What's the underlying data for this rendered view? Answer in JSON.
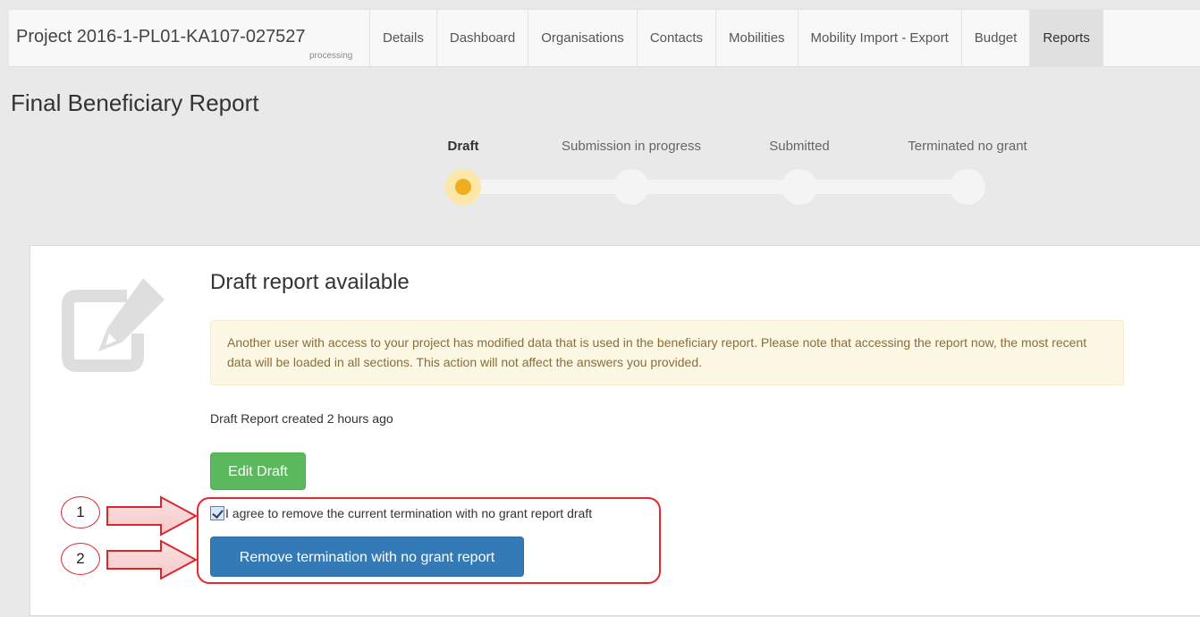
{
  "header": {
    "project_title": "Project 2016-1-PL01-KA107-027527",
    "project_status": "processing",
    "nav": [
      {
        "label": "Details",
        "active": false
      },
      {
        "label": "Dashboard",
        "active": false
      },
      {
        "label": "Organisations",
        "active": false
      },
      {
        "label": "Contacts",
        "active": false
      },
      {
        "label": "Mobilities",
        "active": false
      },
      {
        "label": "Mobility Import - Export",
        "active": false
      },
      {
        "label": "Budget",
        "active": false
      },
      {
        "label": "Reports",
        "active": true
      }
    ]
  },
  "page": {
    "title": "Final Beneficiary Report"
  },
  "steps": [
    {
      "label": "Draft",
      "current": true
    },
    {
      "label": "Submission in progress",
      "current": false
    },
    {
      "label": "Submitted",
      "current": false
    },
    {
      "label": "Terminated no grant",
      "current": false
    }
  ],
  "card": {
    "icon": "edit-document-icon",
    "title": "Draft report available",
    "alert_text": "Another user with access to your project has modified data that is used in the beneficiary report. Please note that accessing the report now, the most recent data will be loaded in all sections. This action will not affect the answers you provided.",
    "created_text": "Draft Report created 2 hours ago",
    "edit_button": "Edit Draft",
    "agree_label": "I agree to remove the current termination with no grant report draft",
    "agree_checked": true,
    "remove_button": "Remove termination with no grant report"
  },
  "annotations": {
    "marker_1": "1",
    "marker_2": "2"
  },
  "colors": {
    "edit_button": "#5cb85c",
    "remove_button": "#337ab7",
    "current_step": "#f0ad1e",
    "annotation_red": "#e8262b",
    "alert_bg": "#fcf8e3"
  }
}
